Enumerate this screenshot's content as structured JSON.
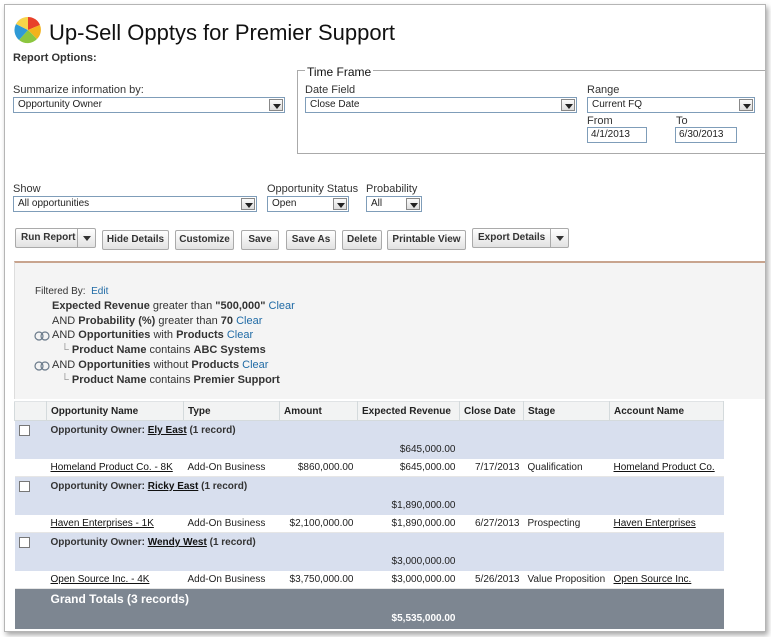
{
  "header": {
    "title": "Up-Sell Opptys for Premier Support",
    "report_options_label": "Report Options:"
  },
  "options": {
    "summarize_label": "Summarize information by:",
    "summarize_value": "Opportunity Owner",
    "timeframe_label": "Time Frame",
    "date_field_label": "Date Field",
    "date_field_value": "Close Date",
    "range_label": "Range",
    "range_value": "Current FQ",
    "from_label": "From",
    "from_value": "4/1/2013",
    "to_label": "To",
    "to_value": "6/30/2013",
    "show_label": "Show",
    "show_value": "All opportunities",
    "status_label": "Opportunity Status",
    "status_value": "Open",
    "probability_label": "Probability",
    "probability_value": "All"
  },
  "toolbar": {
    "run_report": "Run Report",
    "hide_details": "Hide Details",
    "customize": "Customize",
    "save": "Save",
    "save_as": "Save As",
    "delete": "Delete",
    "printable_view": "Printable View",
    "export_details": "Export Details"
  },
  "filters": {
    "filtered_by": "Filtered By:",
    "edit": "Edit",
    "clear": "Clear",
    "f1_field": "Expected Revenue",
    "f1_op": "greater than",
    "f1_value": "\"500,000\"",
    "f2_prefix": "AND",
    "f2_field": "Probability (%)",
    "f2_op": "greater than",
    "f2_value": "70",
    "f3_prefix": "AND",
    "f3_obj": "Opportunities",
    "f3_with": "with",
    "f3_rel": "Products",
    "f3_sub_field": "Product Name",
    "f3_sub_op": "contains",
    "f3_sub_value": "ABC Systems",
    "f4_prefix": "AND",
    "f4_obj": "Opportunities",
    "f4_with": "without",
    "f4_rel": "Products",
    "f4_sub_field": "Product Name",
    "f4_sub_op": "contains",
    "f4_sub_value": "Premier Support"
  },
  "table": {
    "columns": [
      "Opportunity Name",
      "Type",
      "Amount",
      "Expected Revenue",
      "Close Date",
      "Stage",
      "Account Name"
    ],
    "groups": [
      {
        "prefix": "Opportunity Owner:",
        "owner": "Ely East",
        "count": "(1 record)",
        "subtotal": "$645,000.00",
        "row": [
          "Homeland Product Co. - 8K",
          "Add-On Business",
          "$860,000.00",
          "$645,000.00",
          "7/17/2013",
          "Qualification",
          "Homeland Product Co."
        ]
      },
      {
        "prefix": "Opportunity Owner:",
        "owner": "Ricky East",
        "count": "(1 record)",
        "subtotal": "$1,890,000.00",
        "row": [
          "Haven Enterprises - 1K",
          "Add-On Business",
          "$2,100,000.00",
          "$1,890,000.00",
          "6/27/2013",
          "Prospecting",
          "Haven Enterprises"
        ]
      },
      {
        "prefix": "Opportunity Owner:",
        "owner": "Wendy West",
        "count": "(1 record)",
        "subtotal": "$3,000,000.00",
        "row": [
          "Open Source Inc. - 4K",
          "Add-On Business",
          "$3,750,000.00",
          "$3,000,000.00",
          "5/26/2013",
          "Value Proposition",
          "Open Source Inc."
        ]
      }
    ],
    "grand_label": "Grand Totals (3 records)",
    "grand_total": "$5,535,000.00"
  }
}
